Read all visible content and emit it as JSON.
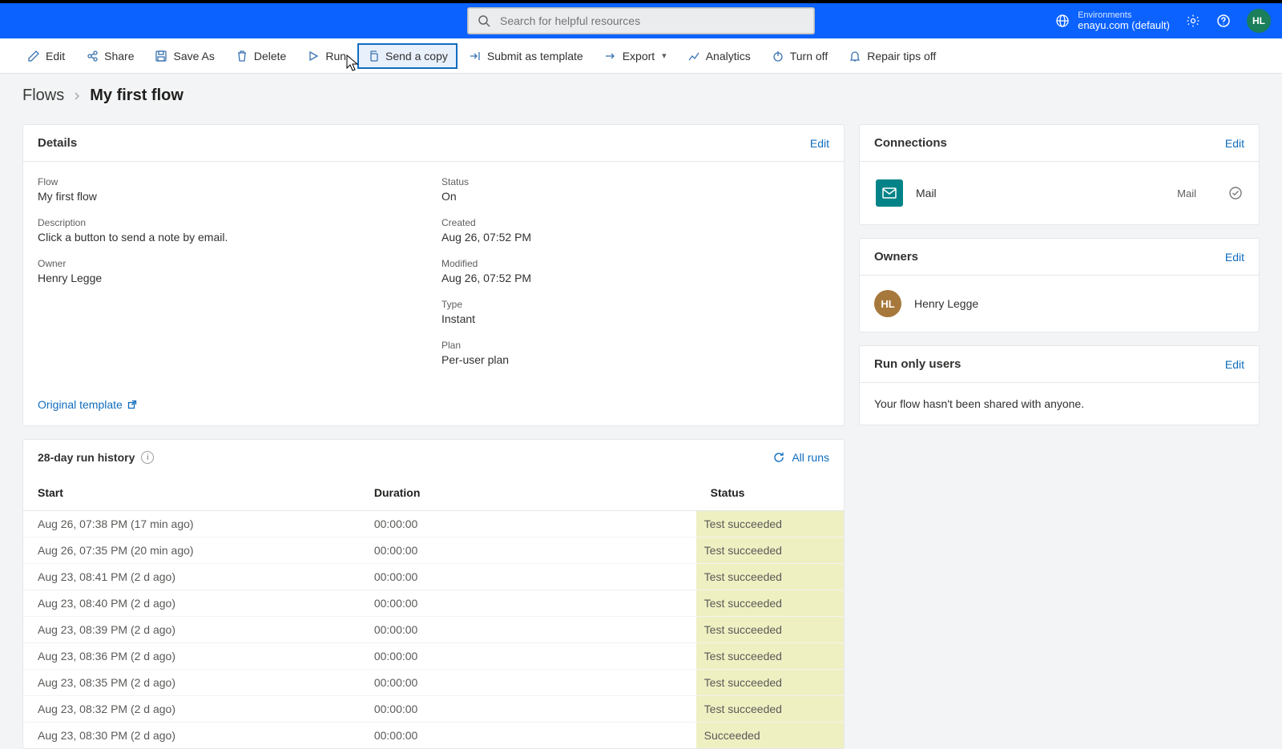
{
  "header": {
    "search_placeholder": "Search for helpful resources",
    "env_label": "Environments",
    "env_name": "enayu.com (default)",
    "avatar_initials": "HL"
  },
  "commands": {
    "edit": "Edit",
    "share": "Share",
    "save_as": "Save As",
    "delete": "Delete",
    "run": "Run",
    "send_copy": "Send a copy",
    "submit_template": "Submit as template",
    "export": "Export",
    "analytics": "Analytics",
    "turn_off": "Turn off",
    "repair_tips": "Repair tips off"
  },
  "breadcrumb": {
    "root": "Flows",
    "current": "My first flow"
  },
  "details": {
    "title": "Details",
    "edit": "Edit",
    "flow_label": "Flow",
    "flow_value": "My first flow",
    "desc_label": "Description",
    "desc_value": "Click a button to send a note by email.",
    "owner_label": "Owner",
    "owner_value": "Henry Legge",
    "status_label": "Status",
    "status_value": "On",
    "created_label": "Created",
    "created_value": "Aug 26, 07:52 PM",
    "modified_label": "Modified",
    "modified_value": "Aug 26, 07:52 PM",
    "type_label": "Type",
    "type_value": "Instant",
    "plan_label": "Plan",
    "plan_value": "Per-user plan",
    "original_template": "Original template"
  },
  "history": {
    "title": "28-day run history",
    "all_runs": "All runs",
    "cols": {
      "start": "Start",
      "duration": "Duration",
      "status": "Status"
    },
    "rows": [
      {
        "start": "Aug 26, 07:38 PM (17 min ago)",
        "duration": "00:00:00",
        "status": "Test succeeded"
      },
      {
        "start": "Aug 26, 07:35 PM (20 min ago)",
        "duration": "00:00:00",
        "status": "Test succeeded"
      },
      {
        "start": "Aug 23, 08:41 PM (2 d ago)",
        "duration": "00:00:00",
        "status": "Test succeeded"
      },
      {
        "start": "Aug 23, 08:40 PM (2 d ago)",
        "duration": "00:00:00",
        "status": "Test succeeded"
      },
      {
        "start": "Aug 23, 08:39 PM (2 d ago)",
        "duration": "00:00:00",
        "status": "Test succeeded"
      },
      {
        "start": "Aug 23, 08:36 PM (2 d ago)",
        "duration": "00:00:00",
        "status": "Test succeeded"
      },
      {
        "start": "Aug 23, 08:35 PM (2 d ago)",
        "duration": "00:00:00",
        "status": "Test succeeded"
      },
      {
        "start": "Aug 23, 08:32 PM (2 d ago)",
        "duration": "00:00:00",
        "status": "Test succeeded"
      },
      {
        "start": "Aug 23, 08:30 PM (2 d ago)",
        "duration": "00:00:00",
        "status": "Succeeded"
      }
    ]
  },
  "connections": {
    "title": "Connections",
    "edit": "Edit",
    "item_name": "Mail",
    "item_sub": "Mail"
  },
  "owners": {
    "title": "Owners",
    "edit": "Edit",
    "initials": "HL",
    "name": "Henry Legge"
  },
  "run_only": {
    "title": "Run only users",
    "edit": "Edit",
    "body": "Your flow hasn't been shared with anyone."
  }
}
